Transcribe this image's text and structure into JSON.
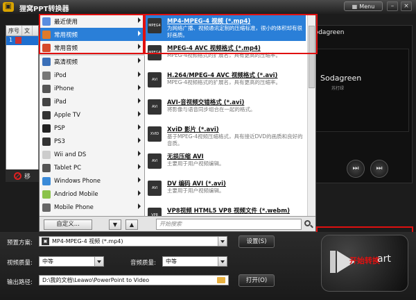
{
  "window": {
    "title": "狸窝PPT转换器",
    "menu_label": "Menu",
    "minimize": "–",
    "close": "×"
  },
  "file_list": {
    "col_index": "序号",
    "col_file": "文",
    "row_index": "1"
  },
  "remove_label": "移",
  "preview": {
    "name": "Sodagreen",
    "album_title": "Sodagreen",
    "album_sub": "苏打绿"
  },
  "categories": [
    {
      "label": "最近使用",
      "color": "#5a8ee0",
      "selected": false
    },
    {
      "label": "常用视频",
      "color": "#e07a2a",
      "selected": true
    },
    {
      "label": "常用音频",
      "color": "#d64a2a",
      "selected": false
    },
    {
      "label": "高清视频",
      "color": "#3a6fb8",
      "selected": false
    },
    {
      "label": "iPod",
      "color": "#777777",
      "selected": false
    },
    {
      "label": "iPhone",
      "color": "#555555",
      "selected": false
    },
    {
      "label": "iPad",
      "color": "#444444",
      "selected": false
    },
    {
      "label": "Apple TV",
      "color": "#333333",
      "selected": false
    },
    {
      "label": "PSP",
      "color": "#222222",
      "selected": false
    },
    {
      "label": "PS3",
      "color": "#333333",
      "selected": false
    },
    {
      "label": "Wii and DS",
      "color": "#cccccc",
      "selected": false
    },
    {
      "label": "Tablet PC",
      "color": "#555555",
      "selected": false
    },
    {
      "label": "Windows Phone",
      "color": "#3a8ad8",
      "selected": false
    },
    {
      "label": "Andriod Mobile",
      "color": "#8ac24a",
      "selected": false
    },
    {
      "label": "Mobile Phone",
      "color": "#666666",
      "selected": false
    }
  ],
  "formats": [
    {
      "title": "MP4-MPEG-4 视频 (*.mp4)",
      "desc": "为网络广播、视频通讯定制的压缩标准，很小的体积却有很好画质。",
      "selected": true,
      "icon": "MPEG4"
    },
    {
      "title": "MPEG-4 AVC 视频格式 (*.mp4)",
      "desc": "MPEG-4视频格式的扩展名，具有更高的压缩率。",
      "selected": false,
      "icon": "MPEG4"
    },
    {
      "title": "H.264/MPEG-4 AVC 视频格式 (*.avi)",
      "desc": "MPEG-4视频格式的扩展名，具有更高的压缩率。",
      "selected": false,
      "icon": "AVI"
    },
    {
      "title": "AVI-音视频交错格式 (*.avi)",
      "desc": "将影像与语音同步组合在一起的格式。",
      "selected": false,
      "icon": "AVI"
    },
    {
      "title": "XviD 影片 (*.avi)",
      "desc": "基于MPEG-4视频压缩格式，具有接近DVD的画质和良好的音质。",
      "selected": false,
      "icon": "XVID"
    },
    {
      "title": "无损压缩 AVI",
      "desc": "主要用于用户视频编辑。",
      "selected": false,
      "icon": "AVI"
    },
    {
      "title": "DV 编码 AVI (*.avi)",
      "desc": "主要用于用户视频编辑。",
      "selected": false,
      "icon": "AVI"
    },
    {
      "title": "VP8视频 HTML5 VP8 视频文件 (*.webm)",
      "desc": "",
      "selected": false,
      "icon": "VP8"
    }
  ],
  "popup_bottom": {
    "custom_label": "自定义...",
    "down_arrow": "▼",
    "up_arrow": "▲",
    "search_placeholder": "开始搜索"
  },
  "settings": {
    "preset_label": "预置方案:",
    "preset_value": "MP4-MPEG-4 视频 (*.mp4)",
    "settings_button": "设置(S)",
    "video_quality_label": "视频质量:",
    "video_quality_value": "中等",
    "audio_quality_label": "音频质量:",
    "audio_quality_value": "中等",
    "output_label": "输出路径:",
    "output_value": "D:\\我的文档\\Leawo\\PowerPoint to Video",
    "open_button": "打开(O)"
  },
  "start": {
    "cn": "开始转换",
    "en": "art"
  },
  "colors": {
    "accent": "#2a7fd8",
    "highlight": "#e01010"
  }
}
